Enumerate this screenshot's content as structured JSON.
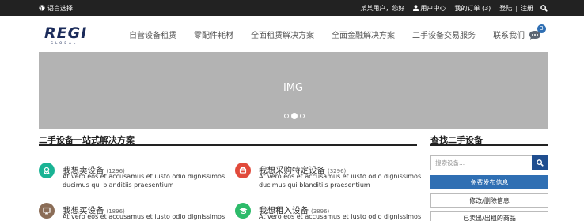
{
  "topbar": {
    "language_label": "语言选择",
    "greeting": "某某用户，您好",
    "user_center": "用户中心",
    "orders": "我的订单 (3)",
    "login": "登陆",
    "separator": "|",
    "register": "注册"
  },
  "header": {
    "logo_text": "REGI",
    "logo_subtext": "GLOBAL",
    "nav": [
      "自营设备租赁",
      "零配件耗材",
      "全面租赁解决方案",
      "全面金融解决方案",
      "二手设备交易服务",
      "联系我们"
    ],
    "chat_badge": "3"
  },
  "banner": {
    "label": "IMG",
    "slides": 3,
    "active_slide": 2
  },
  "main": {
    "title": "二手设备一站式解决方案",
    "services": [
      {
        "name": "我想卖设备",
        "count": "(1296)",
        "desc": "At vero eos et accusamus et iusto odio dignissimos ducimus qui blanditiis praesentium",
        "color": "#1ab394",
        "icon": "sell-icon"
      },
      {
        "name": "我想采购特定设备",
        "count": "(3296)",
        "desc": "At vero eos et accusamus et iusto odio dignissimos ducimus qui blanditiis praesentium",
        "color": "#e14a3b",
        "icon": "purchase-icon"
      },
      {
        "name": "我想买设备",
        "count": "(1896)",
        "desc": "At vero eos et accusamus et iusto odio dignissimos",
        "color": "#8b6d57",
        "icon": "monitor-icon"
      },
      {
        "name": "我想租入设备",
        "count": "(3896)",
        "desc": "At vero eos et accusamus et iusto odio dignissimos",
        "color": "#2dbb6a",
        "icon": "graduation-icon"
      }
    ]
  },
  "sidebar": {
    "title": "查找二手设备",
    "search_placeholder": "搜索设备...",
    "publish": "免费发布信息",
    "edit": "修改/删除信息",
    "sold": "已卖出/出租的商品"
  }
}
